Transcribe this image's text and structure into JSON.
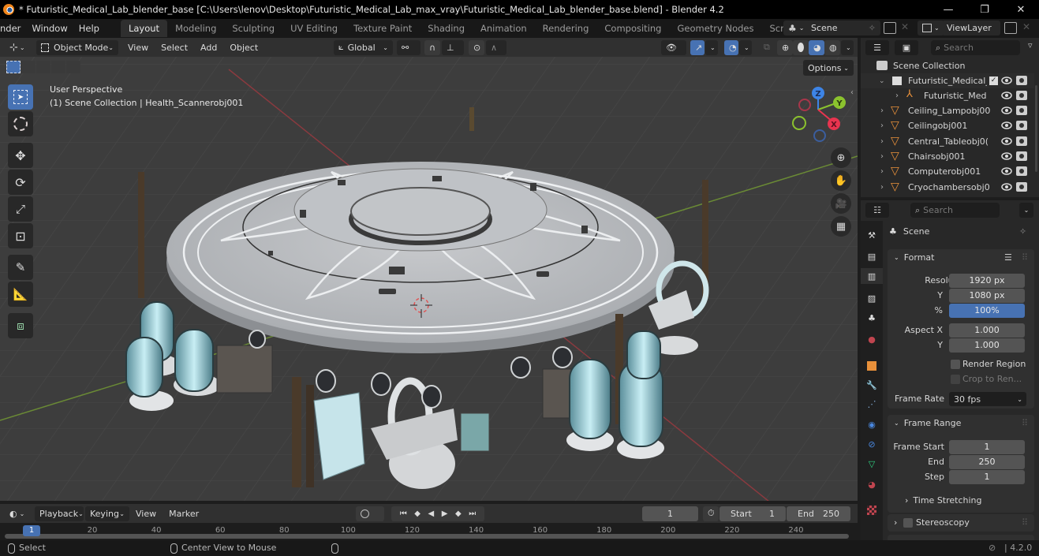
{
  "titlebar": {
    "title": "* Futuristic_Medical_Lab_blender_base [C:\\Users\\lenov\\Desktop\\Futuristic_Medical_Lab_max_vray\\Futuristic_Medical_Lab_blender_base.blend] - Blender 4.2",
    "minimize": "—",
    "maximize": "❐",
    "close": "✕"
  },
  "menubar": {
    "menus": [
      "nder",
      "Window",
      "Help"
    ],
    "workspaces": [
      "Layout",
      "Modeling",
      "Sculpting",
      "UV Editing",
      "Texture Paint",
      "Shading",
      "Animation",
      "Rendering",
      "Compositing",
      "Geometry Nodes",
      "Scripting"
    ],
    "active_workspace": "Layout",
    "add_workspace": "+",
    "scene_name": "Scene",
    "view_layer_name": "ViewLayer"
  },
  "viewport": {
    "mode": "Object Mode",
    "menus": [
      "View",
      "Select",
      "Add",
      "Object"
    ],
    "transform_orientation": "Global",
    "options_label": "Options",
    "overlay_title": "User Perspective",
    "overlay_subtitle": "(1) Scene Collection | Health_Scannerobj001",
    "gizmo_axes": {
      "x": "X",
      "y": "Y",
      "z": "Z"
    },
    "colors": {
      "x_axis": "#e8344f",
      "y_axis": "#8bc22e",
      "z_axis": "#3d84e6",
      "accent": "#4772b3"
    },
    "tools": [
      "select-box",
      "cursor",
      "move",
      "rotate",
      "scale",
      "transform",
      "annotate",
      "measure",
      "add-cube"
    ]
  },
  "outliner": {
    "search_placeholder": "Search",
    "root": "Scene Collection",
    "items": [
      {
        "name": "Futuristic_Medical_",
        "type": "collection",
        "expanded": true,
        "checked": true
      },
      {
        "name": "Futuristic_Med",
        "type": "empty",
        "indent": 2
      },
      {
        "name": "Ceiling_Lampobj00",
        "type": "mesh"
      },
      {
        "name": "Ceilingobj001",
        "type": "mesh"
      },
      {
        "name": "Central_Tableobj0(",
        "type": "mesh"
      },
      {
        "name": "Chairsobj001",
        "type": "mesh"
      },
      {
        "name": "Computerobj001",
        "type": "mesh"
      },
      {
        "name": "Cryochambersobj0",
        "type": "mesh"
      }
    ]
  },
  "properties": {
    "search_placeholder": "Search",
    "context": "Scene",
    "format": {
      "title": "Format",
      "resolution_x_label": "Resolutio...",
      "resolution_x": "1920 px",
      "resolution_y_label": "Y",
      "resolution_y": "1080 px",
      "percent_label": "%",
      "percent": "100%",
      "aspect_x_label": "Aspect X",
      "aspect_x": "1.000",
      "aspect_y_label": "Y",
      "aspect_y": "1.000",
      "render_region": "Render Region",
      "crop_to_render": "Crop to Ren...",
      "frame_rate_label": "Frame Rate",
      "frame_rate": "30 fps"
    },
    "frame_range": {
      "title": "Frame Range",
      "start_label": "Frame Start",
      "start": "1",
      "end_label": "End",
      "end": "250",
      "step_label": "Step",
      "step": "1",
      "time_stretching": "Time Stretching"
    },
    "stereoscopy": "Stereoscopy"
  },
  "timeline": {
    "menus": [
      "Playback",
      "Keying",
      "View",
      "Marker"
    ],
    "current_frame": "1",
    "start_label": "Start",
    "start": "1",
    "end_label": "End",
    "end": "250",
    "ticks": [
      "20",
      "40",
      "60",
      "80",
      "100",
      "120",
      "140",
      "160",
      "180",
      "200",
      "220",
      "240"
    ],
    "playhead": "1"
  },
  "statusbar": {
    "left_hint": "Select",
    "middle_hint": "Center View to Mouse",
    "version": "4.2.0"
  }
}
